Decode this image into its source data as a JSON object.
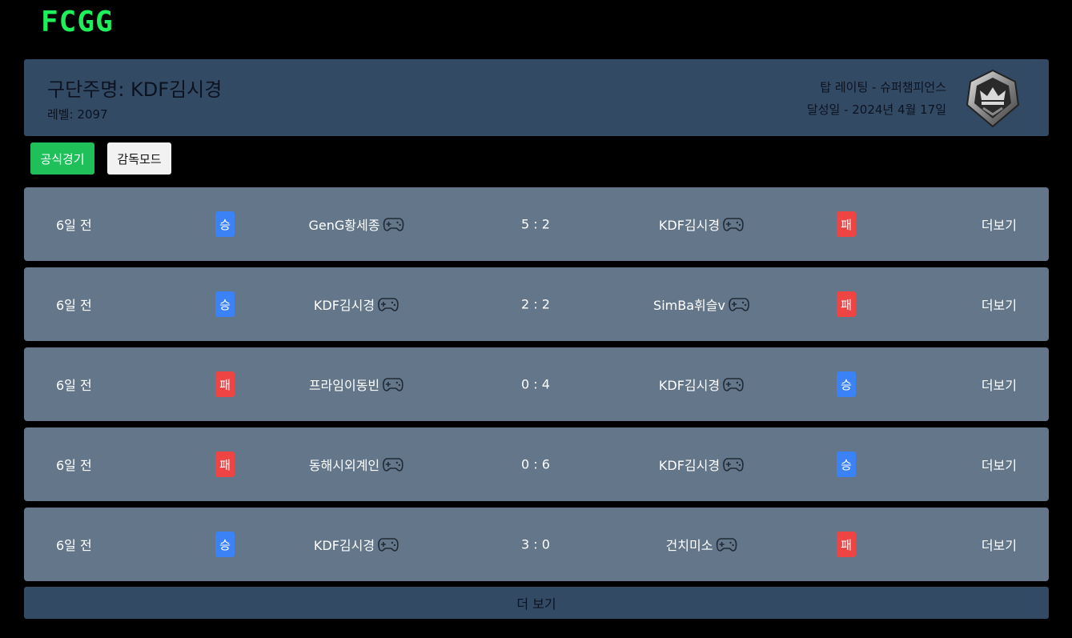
{
  "header": {
    "logo": "FCGG"
  },
  "profile": {
    "name": "구단주명: KDF김시경",
    "level": "레벨: 2097",
    "rating": "탑 레이팅 - 슈퍼챔피언스",
    "achieved": "달성일 - 2024년 4월 17일",
    "badge_icon": "crown-shield-icon"
  },
  "tabs": [
    {
      "label": "공식경기",
      "active": true,
      "color": "#1fc05a"
    },
    {
      "label": "감독모드",
      "active": false
    }
  ],
  "matches": [
    {
      "time": "6일 전",
      "result1": "승",
      "team1": "GenG황세종",
      "score": "5 : 2",
      "team2": "KDF김시경",
      "result2": "패",
      "more": "더보기"
    },
    {
      "time": "6일 전",
      "result1": "승",
      "team1": "KDF김시경",
      "score": "2 : 2",
      "team2": "SimBa휘슬v",
      "result2": "패",
      "more": "더보기"
    },
    {
      "time": "6일 전",
      "result1": "패",
      "team1": "프라임이동빈",
      "score": "0 : 4",
      "team2": "KDF김시경",
      "result2": "승",
      "more": "더보기"
    },
    {
      "time": "6일 전",
      "result1": "패",
      "team1": "동해시외계인",
      "score": "0 : 6",
      "team2": "KDF김시경",
      "result2": "승",
      "more": "더보기"
    },
    {
      "time": "6일 전",
      "result1": "승",
      "team1": "KDF김시경",
      "score": "3 : 0",
      "team2": "건치미소",
      "result2": "패",
      "more": "더보기"
    }
  ],
  "load_more": "더 보기",
  "colors": {
    "win": "#3b82f6",
    "lose": "#ef4444",
    "logo": "#1ef05a",
    "card": "#64768a",
    "panel": "#334a64"
  }
}
